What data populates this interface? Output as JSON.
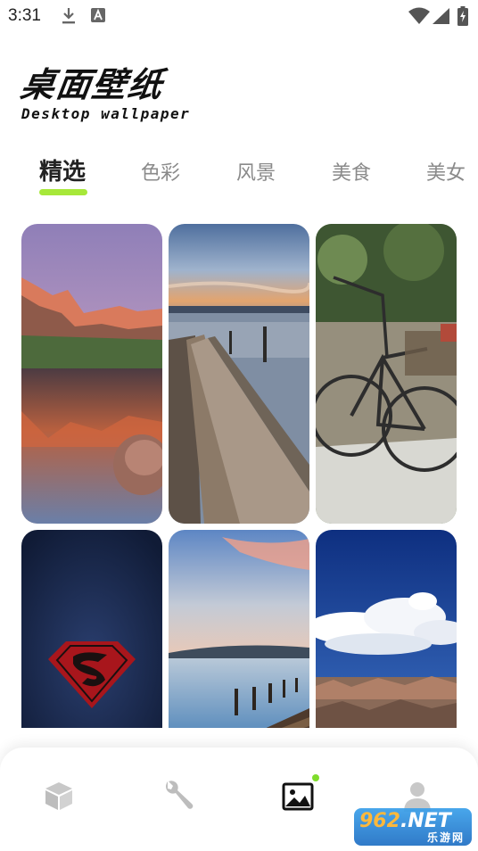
{
  "status_bar": {
    "time": "3:31",
    "icons": [
      "download-icon",
      "a-notification-icon",
      "wifi-icon",
      "signal-icon",
      "battery-charging-icon"
    ]
  },
  "header": {
    "title": "桌面壁纸",
    "subtitle": "Desktop wallpaper"
  },
  "tabs": [
    {
      "label": "精选",
      "active": true
    },
    {
      "label": "色彩",
      "active": false
    },
    {
      "label": "风景",
      "active": false
    },
    {
      "label": "美食",
      "active": false
    },
    {
      "label": "美女",
      "active": false
    }
  ],
  "accent_color": "#a7e83a",
  "wallpapers": [
    {
      "subject": "mountain-lake-sunset"
    },
    {
      "subject": "wooden-pier-sunset"
    },
    {
      "subject": "vintage-bicycle"
    },
    {
      "subject": "superman-logo"
    },
    {
      "subject": "lake-dock-dusk"
    },
    {
      "subject": "canyon-blue-sky"
    }
  ],
  "bottom_nav": {
    "items": [
      {
        "icon": "cube-icon",
        "active": false
      },
      {
        "icon": "wrench-icon",
        "active": false
      },
      {
        "icon": "image-icon",
        "active": true,
        "badge": true
      },
      {
        "icon": "user-icon",
        "active": false
      }
    ]
  },
  "watermark": {
    "main": "962",
    "suffix": ".NET",
    "sub": "乐游网"
  }
}
